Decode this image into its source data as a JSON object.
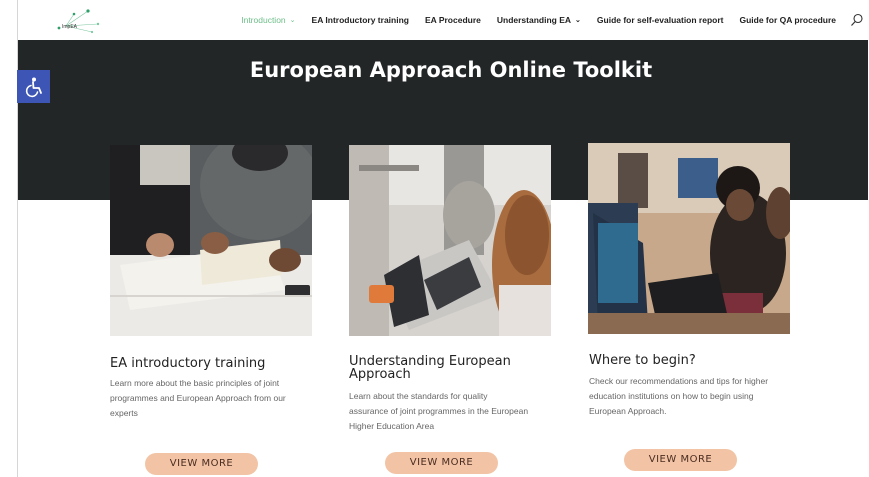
{
  "nav": {
    "logo_text": "ImpEA",
    "items": [
      {
        "label": "Introduction",
        "active": true,
        "has_dropdown": true
      },
      {
        "label": "EA Introductory training",
        "active": false,
        "has_dropdown": false
      },
      {
        "label": "EA Procedure",
        "active": false,
        "has_dropdown": false
      },
      {
        "label": "Understanding EA",
        "active": false,
        "has_dropdown": true
      },
      {
        "label": "Guide for self-evaluation report",
        "active": false,
        "has_dropdown": false
      },
      {
        "label": "Guide for QA procedure",
        "active": false,
        "has_dropdown": false
      }
    ],
    "dropdown_glyph": "⌄",
    "search_icon": "search-icon"
  },
  "hero": {
    "title": "European Approach Online Toolkit"
  },
  "accessibility": {
    "icon": "wheelchair-icon"
  },
  "cards": [
    {
      "title": "EA introductory training",
      "description": "Learn more about the basic principles of joint programmes and European Approach from our experts",
      "button": "VIEW MORE",
      "image": "photo-reading-documents"
    },
    {
      "title": "Understanding European Approach",
      "description": "Learn about the standards for quality assurance of joint programmes in the European Higher Education Area",
      "button": "VIEW MORE",
      "image": "photo-laptop-user"
    },
    {
      "title": "Where to begin?",
      "description": "Check our recommendations and tips for higher education institutions on how to begin using European Approach.",
      "button": "VIEW MORE",
      "image": "photo-students-computers"
    }
  ],
  "colors": {
    "hero_bg": "#222627",
    "accent_green": "#6fbf8a",
    "button_bg": "#f2c4a5",
    "accessibility_bg": "#3d55b4"
  }
}
